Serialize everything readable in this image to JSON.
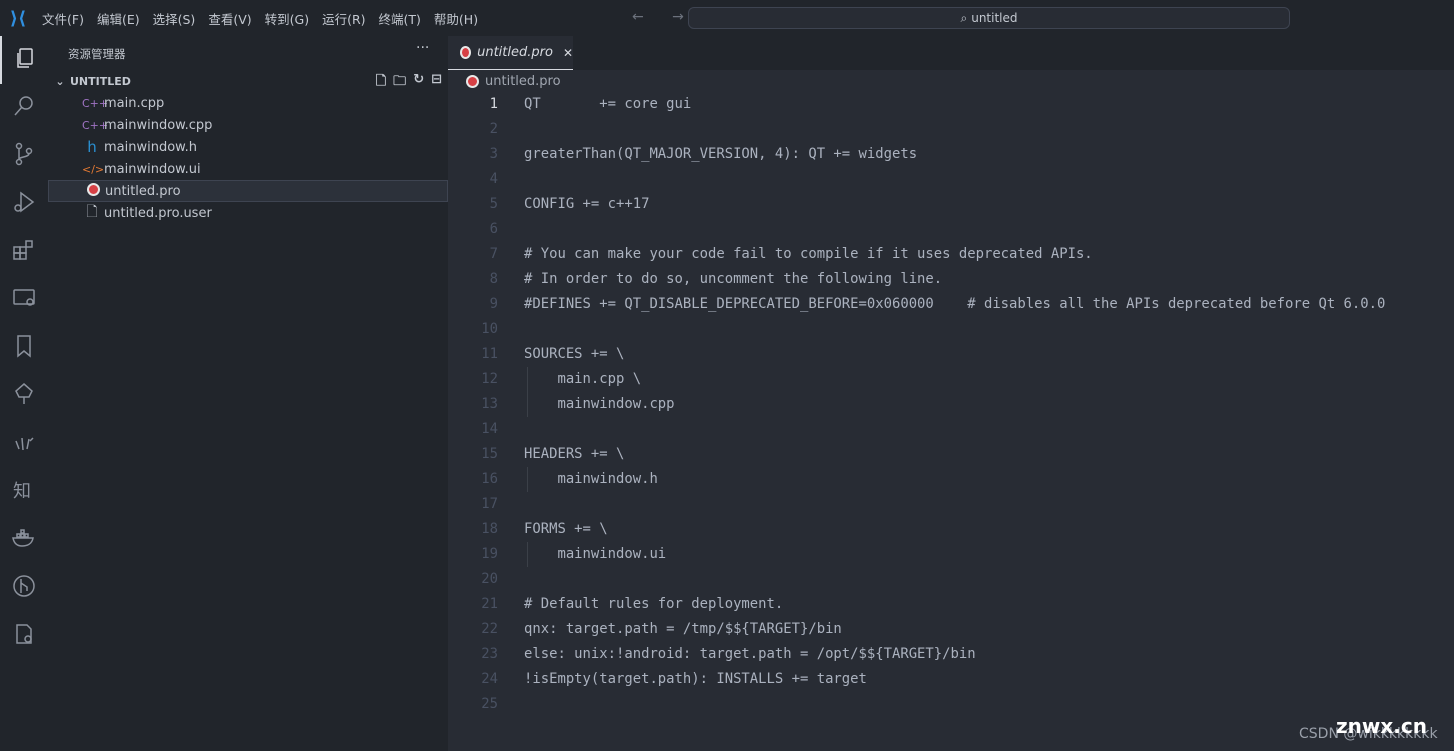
{
  "menu": [
    "文件(F)",
    "编辑(E)",
    "选择(S)",
    "查看(V)",
    "转到(G)",
    "运行(R)",
    "终端(T)",
    "帮助(H)"
  ],
  "nav": "← →",
  "search": {
    "icon": "search-icon",
    "text": "untitled"
  },
  "activity": [
    "explorer",
    "search",
    "source-control",
    "run-debug",
    "extensions",
    "remote-explorer",
    "bookmarks",
    "tree",
    "hand",
    "zhi",
    "docker",
    "git-graph",
    "settings-sync"
  ],
  "sidebar": {
    "title": "资源管理器",
    "more": "···",
    "section": "UNTITLED",
    "chevron": "⌄",
    "files": [
      {
        "name": "main.cpp",
        "icon": "C++",
        "color": "#a074c4"
      },
      {
        "name": "mainwindow.cpp",
        "icon": "C++",
        "color": "#a074c4"
      },
      {
        "name": "mainwindow.h",
        "icon": "h",
        "color": "#2a8fd0"
      },
      {
        "name": "mainwindow.ui",
        "icon": "</>",
        "color": "#e37933"
      },
      {
        "name": "untitled.pro",
        "icon": "qt",
        "color": "#d64045"
      },
      {
        "name": "untitled.pro.user",
        "icon": "file",
        "color": "#c3c8d0"
      }
    ],
    "selected": "untitled.pro"
  },
  "tab": {
    "label": "untitled.pro",
    "close": "✕"
  },
  "breadcrumb": "untitled.pro",
  "current_line": 1,
  "code": [
    "QT       += core gui",
    "",
    "greaterThan(QT_MAJOR_VERSION, 4): QT += widgets",
    "",
    "CONFIG += c++17",
    "",
    "# You can make your code fail to compile if it uses deprecated APIs.",
    "# In order to do so, uncomment the following line.",
    "#DEFINES += QT_DISABLE_DEPRECATED_BEFORE=0x060000    # disables all the APIs deprecated before Qt 6.0.0",
    "",
    "SOURCES += \\",
    "    main.cpp \\",
    "    mainwindow.cpp",
    "",
    "HEADERS += \\",
    "    mainwindow.h",
    "",
    "FORMS += \\",
    "    mainwindow.ui",
    "",
    "# Default rules for deployment.",
    "qnx: target.path = /tmp/$${TARGET}/bin",
    "else: unix:!android: target.path = /opt/$${TARGET}/bin",
    "!isEmpty(target.path): INSTALLS += target",
    ""
  ],
  "watermark": {
    "site": "znwx.cn",
    "author": "CSDN @wikkkkkkkk"
  }
}
